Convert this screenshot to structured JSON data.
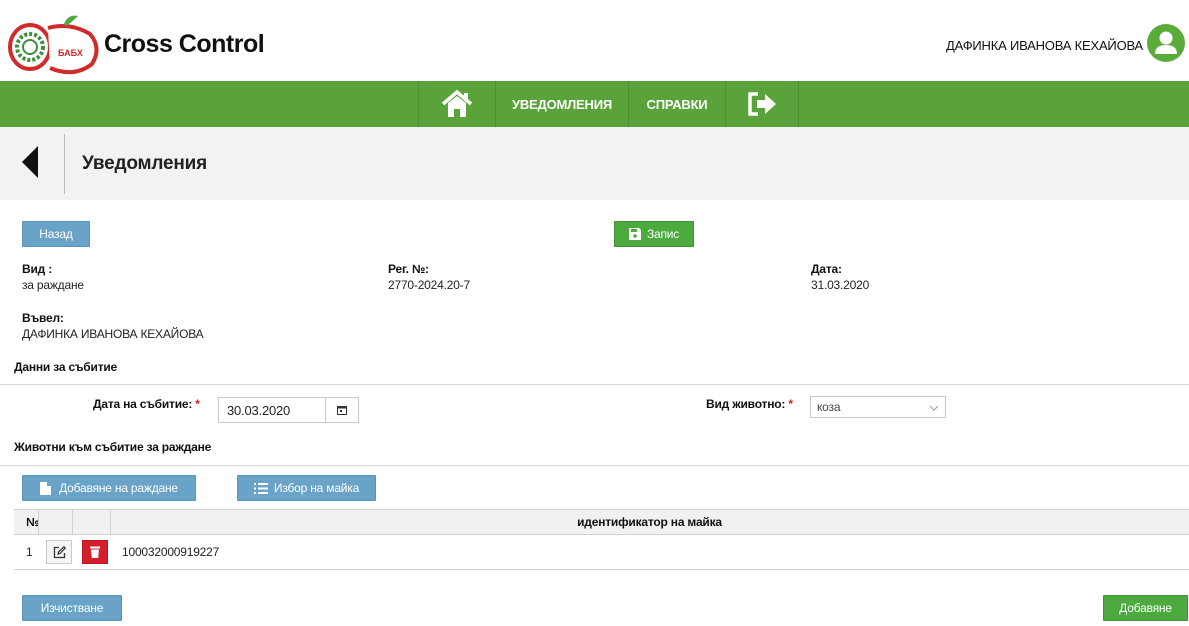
{
  "header": {
    "brand": "Cross Control",
    "logo_text": "БАБХ",
    "user_name": "ДАФИНКА ИВАНОВА КЕХАЙОВА"
  },
  "nav": {
    "home_icon": "home-icon",
    "items": [
      {
        "label": "УВЕДОМЛЕНИЯ"
      },
      {
        "label": "СПРАВКИ"
      }
    ],
    "logout_icon": "logout-icon"
  },
  "page": {
    "title": "Уведомления"
  },
  "toolbar": {
    "back_label": "Назад",
    "save_label": "Запис"
  },
  "info": {
    "type_label": "Вид :",
    "type_value": "за раждане",
    "reg_label": "Рег. №:",
    "reg_value": "2770-2024.20-7",
    "date_label": "Дата:",
    "date_value": "31.03.2020",
    "entered_label": "Въвел:",
    "entered_value": "ДАФИНКА ИВАНОВА КЕХАЙОВА"
  },
  "event": {
    "section_title": "Данни за събитие",
    "date_label": "Дата на събитие:",
    "date_value": "30.03.2020",
    "animal_label": "Вид животно:",
    "animal_value": "коза",
    "required_mark": "*"
  },
  "animals": {
    "section_title": "Животни към събитие за раждане",
    "add_birth_label": "Добавяне на раждане",
    "choose_mother_label": "Избор на майка",
    "columns": {
      "num": "№",
      "mother_id": "идентификатор на майка"
    },
    "rows": [
      {
        "num": "1",
        "mother_id": "100032000919227"
      }
    ]
  },
  "footer": {
    "clear_label": "Изчистване",
    "add_label": "Добавяне"
  },
  "colors": {
    "nav_green": "#5aa33b",
    "button_blue": "#6aa3c8",
    "button_green": "#4caa3f",
    "delete_red": "#d21f2b"
  }
}
